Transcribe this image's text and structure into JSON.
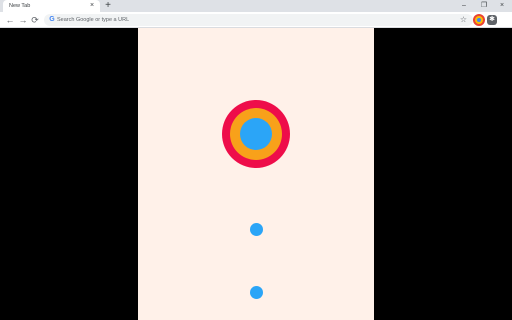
{
  "browser": {
    "tab_title": "New Tab",
    "tab_close": "×",
    "new_tab": "+",
    "window_minimize": "–",
    "window_restore": "❐",
    "window_close": "×",
    "back": "←",
    "forward": "→",
    "reload": "⟳",
    "omnibox_placeholder": "Search Google or type a URL",
    "google_glyph": "G",
    "bookmark_star": "☆",
    "extension_puzzle": "✱"
  },
  "game": {
    "background_color": "#fff1e9",
    "target_colors": [
      "#ee0d4a",
      "#f8a11a",
      "#2ba5f7"
    ],
    "ball_color": "#2ba5f7",
    "ball_count": 2
  },
  "icons": [
    "back-icon",
    "forward-icon",
    "reload-icon",
    "google-icon",
    "star-icon",
    "profile-icon",
    "puzzle-icon"
  ]
}
